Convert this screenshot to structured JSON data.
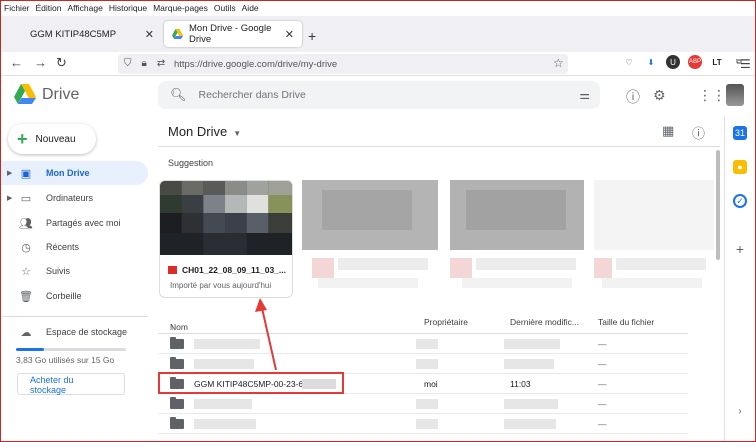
{
  "menubar": [
    "Fichier",
    "Édition",
    "Affichage",
    "Historique",
    "Marque-pages",
    "Outils",
    "Aide"
  ],
  "tabs": [
    {
      "title": "GGM KITIP48C5MP",
      "active": false
    },
    {
      "title": "Mon Drive - Google Drive",
      "active": true
    }
  ],
  "nav": {
    "url": "https://drive.google.com/drive/my-drive"
  },
  "drive": {
    "brand": "Drive",
    "search_placeholder": "Rechercher dans Drive"
  },
  "sidebar": {
    "new_label": "Nouveau",
    "items": [
      {
        "label": "Mon Drive",
        "icon": "drive-icon",
        "active": true
      },
      {
        "label": "Ordinateurs",
        "icon": "computer-icon"
      },
      {
        "label": "Partagés avec moi",
        "icon": "people-icon"
      },
      {
        "label": "Récents",
        "icon": "clock-icon"
      },
      {
        "label": "Suivis",
        "icon": "star-icon"
      },
      {
        "label": "Corbeille",
        "icon": "trash-icon"
      }
    ],
    "storage_label": "Espace de stockage",
    "storage_text": "3,83 Go utilisés sur 15 Go",
    "storage_fraction": 0.255,
    "buy_label_1": "Acheter du",
    "buy_label_2": "stockage"
  },
  "main": {
    "title": "Mon Drive",
    "suggestion_label": "Suggestion",
    "card": {
      "name": "CH01_22_08_09_11_03_...",
      "subtitle": "Importé par vous aujourd'hui"
    },
    "columns": {
      "name": "Nom",
      "owner": "Propriétaire",
      "modified": "Dernière modific...",
      "size": "Taille du fichier"
    },
    "rows": [
      {
        "name": "",
        "owner": "",
        "modified": "",
        "size": "—",
        "blur": true
      },
      {
        "name": "",
        "owner": "",
        "modified": "",
        "size": "—",
        "blur": true
      },
      {
        "name": "GGM KITIP48C5MP-00-23-63-",
        "owner": "moi",
        "modified": "11:03",
        "size": "—",
        "blur": false
      },
      {
        "name": "",
        "owner": "",
        "modified": "",
        "size": "—",
        "blur": true
      },
      {
        "name": "",
        "owner": "",
        "modified": "",
        "size": "—",
        "blur": true
      }
    ]
  },
  "colors": {
    "accent": "#1a73e8",
    "highlight": "#e53935",
    "active_bg": "#e8f0fe"
  }
}
